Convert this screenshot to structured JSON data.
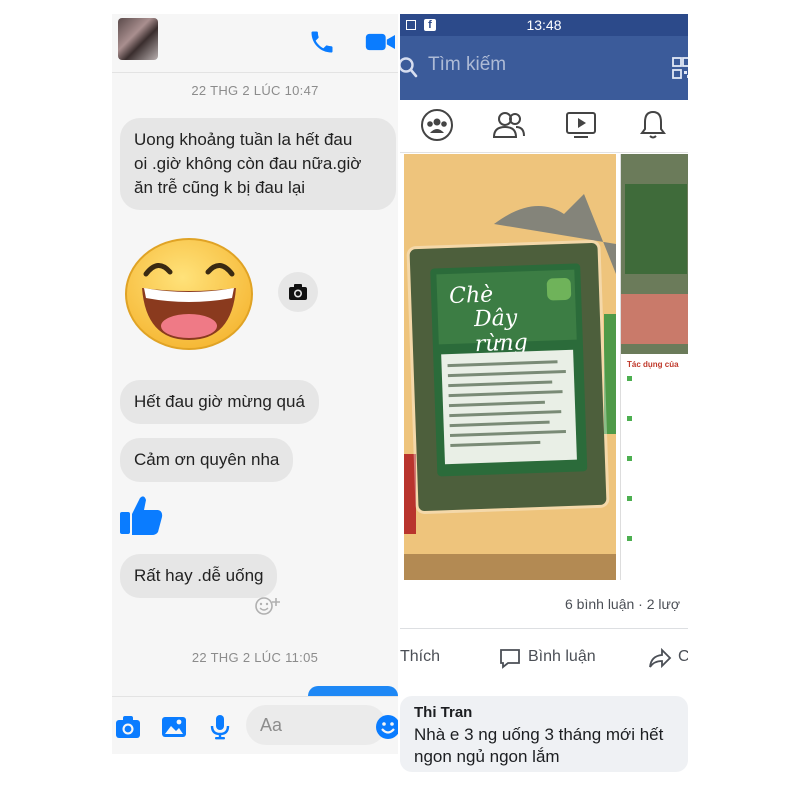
{
  "messenger": {
    "conversation": [
      {
        "kind": "timestamp",
        "text": "22 THG 2 LÚC 10:47"
      },
      {
        "kind": "message",
        "lines": [
          "Uong khoảng tuần la hết đau",
          "oi .giờ không còn đau nữa.giờ",
          "ăn trễ cũng k bị đau lại"
        ]
      },
      {
        "kind": "message",
        "text": "Hết đau giờ mừng quá"
      },
      {
        "kind": "message",
        "text": "Cảm ơn  quyên nha"
      },
      {
        "kind": "message",
        "text": "Rất hay .dễ uống"
      },
      {
        "kind": "timestamp",
        "text": "22 THG 2 LÚC 11:05"
      }
    ],
    "composer": {
      "placeholder": "Aa"
    },
    "icons": [
      "phone-icon",
      "video-icon",
      "laughing-emoji-sticker",
      "camera-icon",
      "thumbs-up-icon",
      "add-reaction-icon",
      "image-icon",
      "microphone-icon",
      "emoji-icon"
    ],
    "colors": {
      "accent": "#0a7cff",
      "bubble": "#e6e6e6"
    }
  },
  "facebook": {
    "status_time": "13:48",
    "search_placeholder": "Tìm kiếm",
    "post": {
      "product_name_line1": "Chè",
      "product_name_line2": "Dây rừng",
      "photo2_heading": "Tác dụng của",
      "counts": "6 bình luận · 2 lượ",
      "actions": {
        "like": "Thích",
        "comment": "Bình luận",
        "share": "C"
      }
    },
    "comment": {
      "author": "Thi Tran",
      "text": "Nhà e 3 ng uống 3 tháng mới hết",
      "text2": "ngon ngủ ngon lắm"
    },
    "colors": {
      "header": "#3b5b9a",
      "statusbar": "#2c4a8a"
    }
  }
}
